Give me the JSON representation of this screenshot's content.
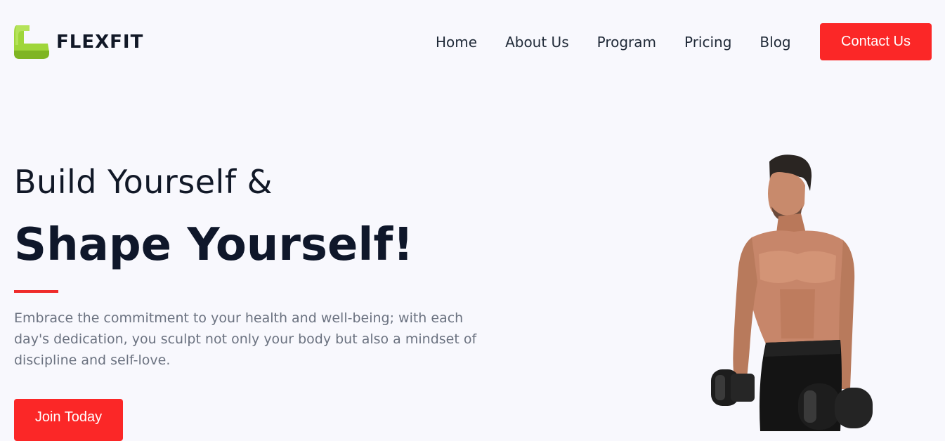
{
  "brand": {
    "name": "FLEXFIT",
    "logo_icon": "flexed-arm-icon",
    "logo_color": "#9acd32"
  },
  "nav": {
    "items": [
      "Home",
      "About Us",
      "Program",
      "Pricing",
      "Blog"
    ]
  },
  "header": {
    "cta_label": "Contact Us"
  },
  "hero": {
    "title_line1": "Build Yourself &",
    "title_line2": "Shape Yourself!",
    "description": "Embrace the commitment to your health and well-being; with each day's dedication, you sculpt not only your body but also a mindset of discipline and self-love.",
    "cta_label": "Join Today",
    "image": "man-with-dumbbells-photo"
  },
  "colors": {
    "accent": "#fb2727",
    "text_dark": "#0f172a",
    "text_muted": "#6b7280",
    "background": "#f8f8fd"
  }
}
